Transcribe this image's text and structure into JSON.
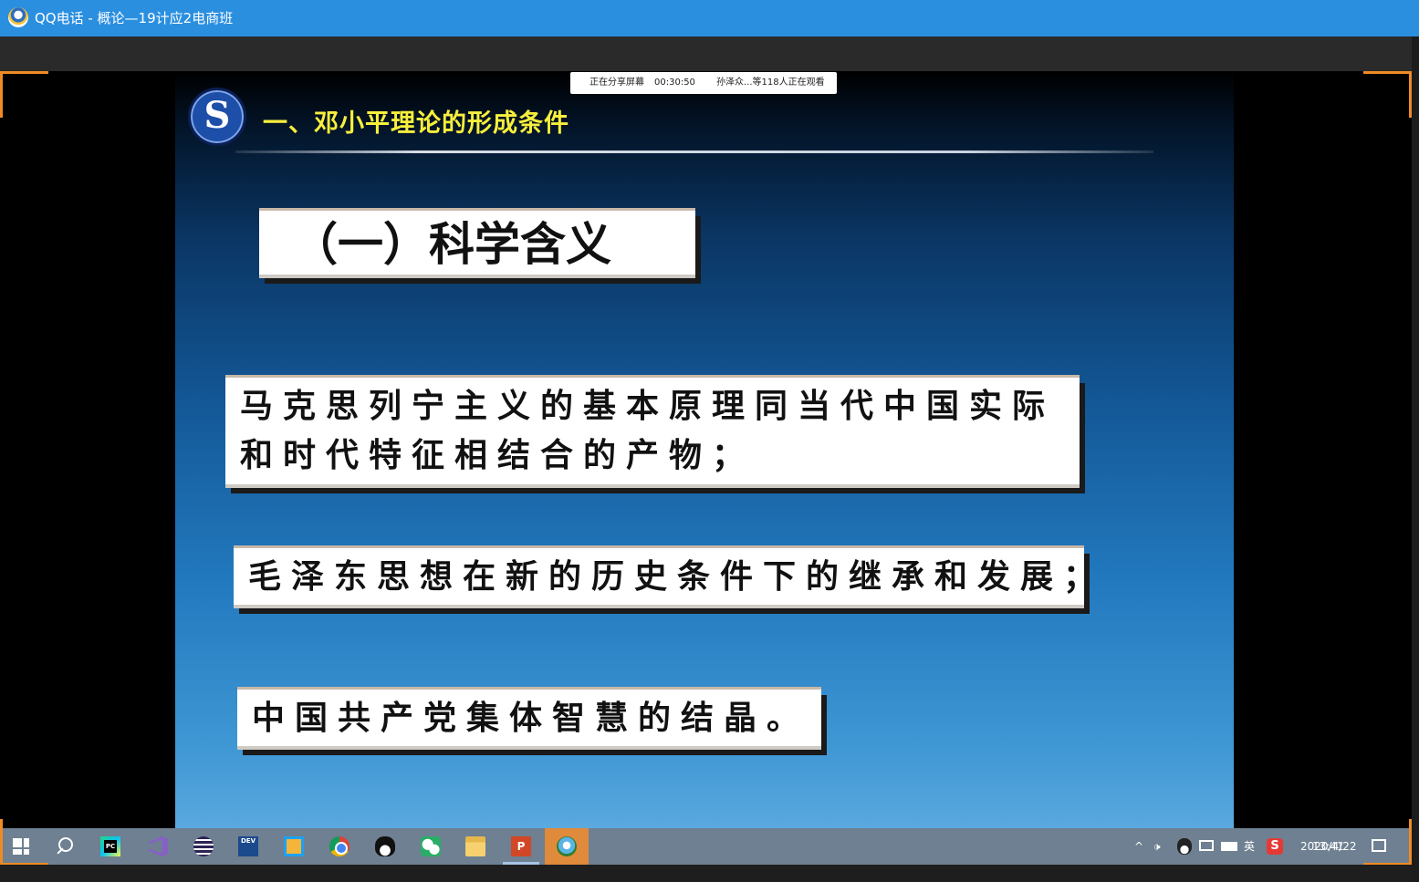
{
  "window": {
    "title": "QQ电话  -  概论—19计应2电商班",
    "icon": "qq-call-icon"
  },
  "share_status": {
    "label": "正在分享屏幕",
    "timer": "00:30:50",
    "viewers": "孙泽众...等118人正在观看"
  },
  "slide": {
    "logo_letter": "S",
    "heading": "一、邓小平理论的形成条件",
    "section_title": "（一）科学含义",
    "points": [
      "马克思列宁主义的基本原理同当代中国实际和时代特征相结合的产物；",
      "毛泽东思想在新的历史条件下的继承和发展；",
      "中国共产党集体智慧的结晶。"
    ],
    "colors": {
      "heading": "#f7ef3c",
      "background_top": "#000000",
      "background_bottom": "#5aa9df"
    }
  },
  "taskbar": {
    "apps": [
      "start-icon",
      "search-icon",
      "pycharm-icon",
      "visual-studio-icon",
      "eclipse-icon",
      "devcpp-icon",
      "snipping-tool-icon",
      "chrome-icon",
      "qq-icon",
      "wechat-icon",
      "file-explorer-icon",
      "powerpoint-icon",
      "qq-call-icon"
    ],
    "pycharm_label": "PC",
    "devcpp_label": "DEV",
    "ppt_label": "P",
    "tray": {
      "up_arrow": "^",
      "volume": "🕩",
      "language": "英",
      "sogou": "S",
      "time": "13:41",
      "date": "2020/4/22"
    }
  },
  "accent_color": "#f08a24"
}
